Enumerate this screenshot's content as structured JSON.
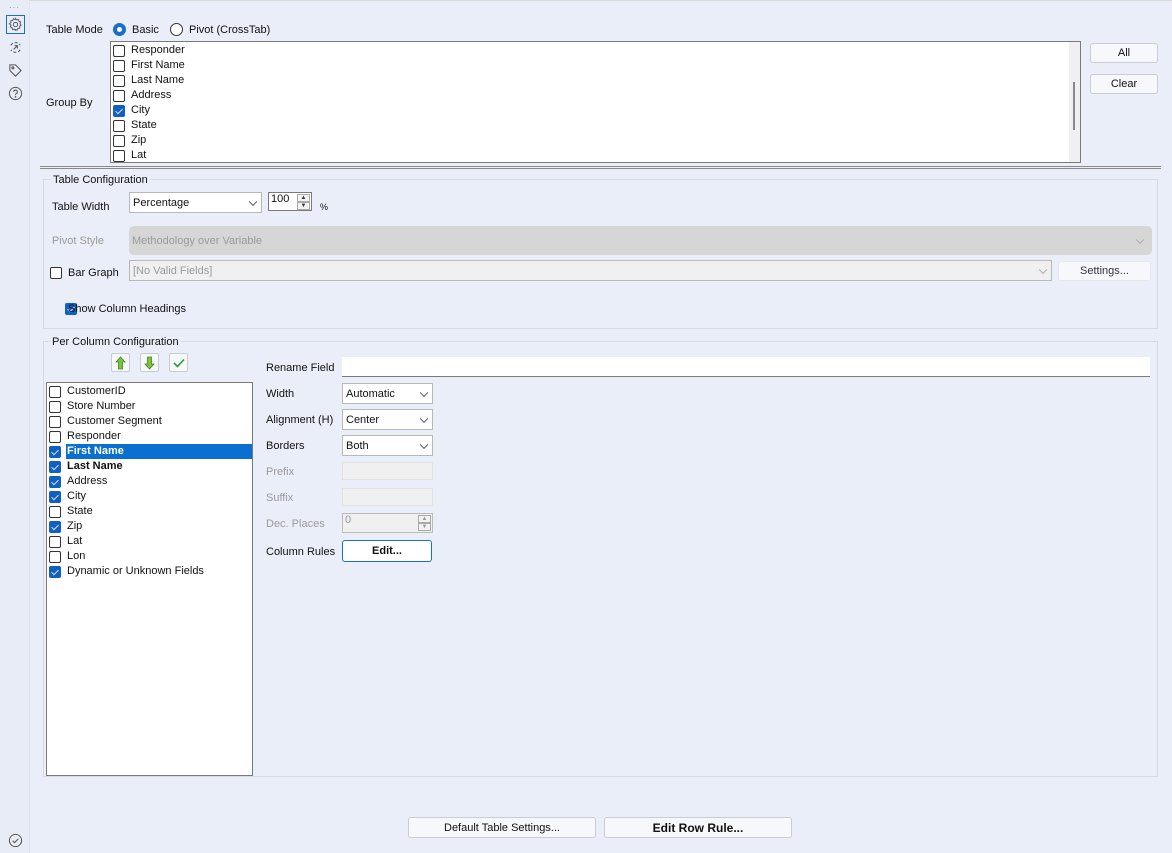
{
  "sidebar": {
    "icons": [
      {
        "name": "settings-gear-icon",
        "active": true
      },
      {
        "name": "connection-arrow-icon",
        "active": false
      },
      {
        "name": "tag-icon",
        "active": false
      },
      {
        "name": "help-icon",
        "active": false
      }
    ],
    "footer_icon": "check-circle-icon"
  },
  "table_mode": {
    "label": "Table Mode",
    "options": [
      {
        "label": "Basic",
        "selected": true
      },
      {
        "label": "Pivot (CrossTab)",
        "selected": false
      }
    ]
  },
  "group_by": {
    "label": "Group By",
    "items": [
      {
        "label": "Responder",
        "checked": false
      },
      {
        "label": "First Name",
        "checked": false
      },
      {
        "label": "Last Name",
        "checked": false
      },
      {
        "label": "Address",
        "checked": false
      },
      {
        "label": "City",
        "checked": true
      },
      {
        "label": "State",
        "checked": false
      },
      {
        "label": "Zip",
        "checked": false
      },
      {
        "label": "Lat",
        "checked": false
      }
    ],
    "all_label": "All",
    "clear_label": "Clear"
  },
  "table_config": {
    "title": "Table Configuration",
    "table_width_label": "Table Width",
    "table_width_value": "Percentage",
    "width_number": "100",
    "percent_symbol": "%",
    "pivot_style_label": "Pivot Style",
    "pivot_style_value": "Methodology over Variable",
    "bar_graph_label": "Bar Graph",
    "bar_graph_checked": false,
    "bar_graph_value": "[No Valid Fields]",
    "settings_label": "Settings...",
    "show_headings_label": "Show Column Headings",
    "show_headings_checked": true
  },
  "per_column": {
    "title": "Per Column Configuration",
    "toolbar": [
      "move-up-icon",
      "move-down-icon",
      "check-all-icon"
    ],
    "columns": [
      {
        "label": "CustomerID",
        "checked": false,
        "bold": false,
        "selected": false
      },
      {
        "label": "Store Number",
        "checked": false,
        "bold": false,
        "selected": false
      },
      {
        "label": "Customer Segment",
        "checked": false,
        "bold": false,
        "selected": false
      },
      {
        "label": "Responder",
        "checked": false,
        "bold": false,
        "selected": false
      },
      {
        "label": "First Name",
        "checked": true,
        "bold": true,
        "selected": true
      },
      {
        "label": "Last Name",
        "checked": true,
        "bold": true,
        "selected": false
      },
      {
        "label": "Address",
        "checked": true,
        "bold": false,
        "selected": false
      },
      {
        "label": "City",
        "checked": true,
        "bold": false,
        "selected": false
      },
      {
        "label": "State",
        "checked": false,
        "bold": false,
        "selected": false
      },
      {
        "label": "Zip",
        "checked": true,
        "bold": false,
        "selected": false
      },
      {
        "label": "Lat",
        "checked": false,
        "bold": false,
        "selected": false
      },
      {
        "label": "Lon",
        "checked": false,
        "bold": false,
        "selected": false
      },
      {
        "label": "Dynamic or Unknown Fields",
        "checked": true,
        "bold": false,
        "selected": false
      }
    ],
    "rename_label": "Rename Field",
    "rename_value": "",
    "width_label": "Width",
    "width_value": "Automatic",
    "alignment_label": "Alignment (H)",
    "alignment_value": "Center",
    "borders_label": "Borders",
    "borders_value": "Both",
    "prefix_label": "Prefix",
    "prefix_value": "",
    "suffix_label": "Suffix",
    "suffix_value": "",
    "dec_places_label": "Dec. Places",
    "dec_places_value": "0",
    "column_rules_label": "Column Rules",
    "edit_label": "Edit..."
  },
  "footer": {
    "default_settings_label": "Default Table Settings...",
    "edit_row_rule_label": "Edit Row Rule..."
  }
}
